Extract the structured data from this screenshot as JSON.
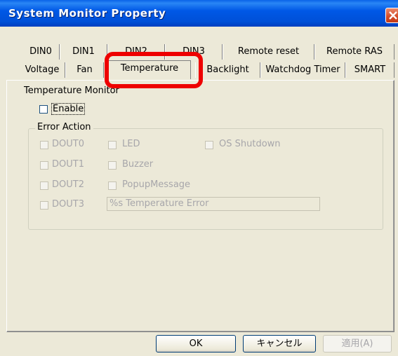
{
  "window": {
    "title": "System Monitor Property"
  },
  "tabs_row1": [
    "DIN0",
    "DIN1",
    "DIN2",
    "DIN3",
    "Remote reset",
    "Remote RAS"
  ],
  "tabs_row2": [
    "Voltage",
    "Fan",
    "Temperature",
    "Backlight",
    "Watchdog Timer",
    "SMART"
  ],
  "active_tab": "Temperature",
  "temperature_monitor": {
    "heading": "Temperature Monitor",
    "enable_label": "Enable",
    "enable_checked": false
  },
  "error_action": {
    "group_label": "Error Action",
    "dout0": "DOUT0",
    "dout1": "DOUT1",
    "dout2": "DOUT2",
    "dout3": "DOUT3",
    "led": "LED",
    "buzzer": "Buzzer",
    "popup": "PopupMessage",
    "os_shutdown": "OS Shutdown",
    "message_value": "%s Temperature Error"
  },
  "buttons": {
    "ok": "OK",
    "cancel": "キャンセル",
    "apply": "適用(A)"
  }
}
